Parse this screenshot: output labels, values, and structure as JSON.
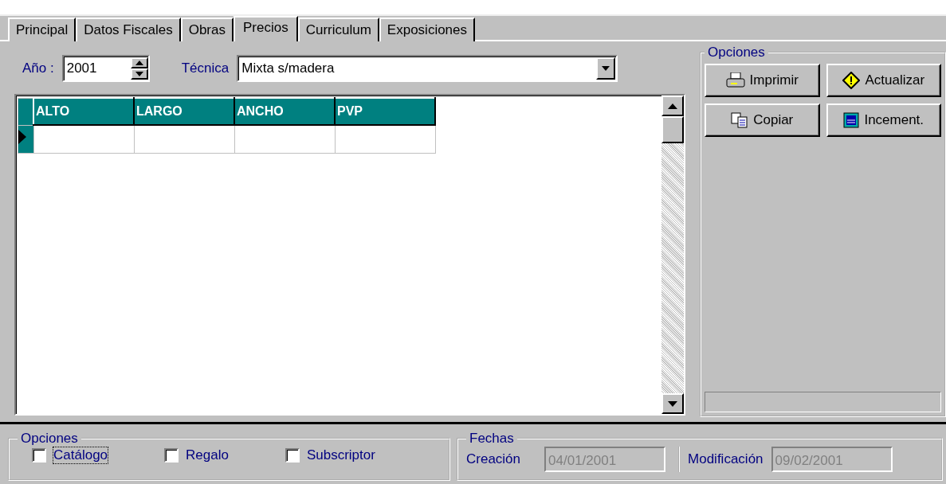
{
  "tabs": [
    {
      "label": "Principal",
      "selected": false
    },
    {
      "label": "Datos Fiscales",
      "selected": false
    },
    {
      "label": "Obras",
      "selected": false
    },
    {
      "label": "Precios",
      "selected": true
    },
    {
      "label": "Curriculum",
      "selected": false
    },
    {
      "label": "Exposiciones",
      "selected": false
    }
  ],
  "year": {
    "label": "Año :",
    "value": "2001"
  },
  "technique": {
    "label": "Técnica",
    "value": "Mixta s/madera"
  },
  "table": {
    "columns": [
      "ALTO",
      "LARGO",
      "ANCHO",
      "PVP"
    ],
    "rows": [
      {
        "current": true,
        "cells": [
          "",
          "",
          "",
          ""
        ]
      }
    ]
  },
  "options_panel": {
    "title": "Opciones",
    "buttons": [
      {
        "label": "Imprimir",
        "kind": "print"
      },
      {
        "label": "Actualizar",
        "kind": "update"
      },
      {
        "label": "Copiar",
        "kind": "copy"
      },
      {
        "label": "Incement.",
        "kind": "increment"
      }
    ]
  },
  "options_group": {
    "title": "Opciones",
    "checkboxes": [
      {
        "label": "Catálogo",
        "checked": false,
        "focused": true
      },
      {
        "label": "Regalo",
        "checked": false,
        "focused": false
      },
      {
        "label": "Subscriptor",
        "checked": false,
        "focused": false
      }
    ]
  },
  "dates_group": {
    "title": "Fechas",
    "fields": [
      {
        "label": "Creación",
        "value": "04/01/2001",
        "disabled": true
      },
      {
        "label": "Modificación",
        "value": "09/02/2001",
        "disabled": true
      }
    ]
  }
}
